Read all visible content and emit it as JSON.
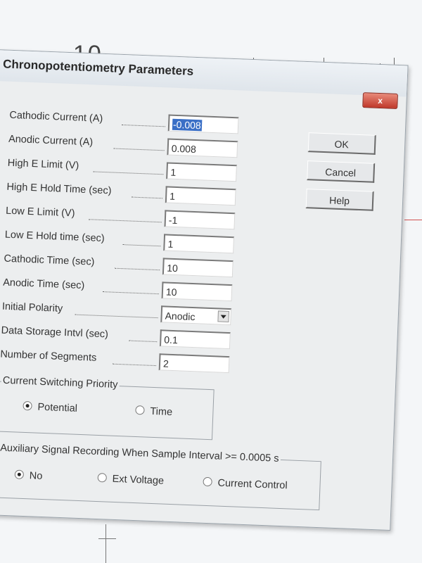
{
  "background": {
    "ruler_label": "10"
  },
  "dialog": {
    "title": "Chronopotentiometry Parameters",
    "close_label": "x"
  },
  "fields": [
    {
      "label": "Cathodic Current (A)",
      "value": "-0.008",
      "selected": true
    },
    {
      "label": "Anodic Current (A)",
      "value": "0.008"
    },
    {
      "label": "High E Limit (V)",
      "value": "1"
    },
    {
      "label": "High E Hold Time (sec)",
      "value": "1"
    },
    {
      "label": "Low E Limit (V)",
      "value": "-1"
    },
    {
      "label": "Low E Hold time (sec)",
      "value": "1"
    },
    {
      "label": "Cathodic Time (sec)",
      "value": "10"
    },
    {
      "label": "Anodic Time (sec)",
      "value": "10"
    },
    {
      "label": "Initial Polarity",
      "value": "Anodic",
      "type": "select"
    },
    {
      "label": "Data Storage Intvl (sec)",
      "value": "0.1"
    },
    {
      "label": "Number of Segments",
      "value": "2"
    }
  ],
  "buttons": {
    "ok": "OK",
    "cancel": "Cancel",
    "help": "Help"
  },
  "switching_group": {
    "title": "Current Switching Priority",
    "options": [
      "Potential",
      "Time"
    ],
    "selected": "Potential"
  },
  "aux_group": {
    "title": "Auxiliary Signal Recording When Sample Interval >= 0.0005 s",
    "options": [
      "No",
      "Ext Voltage",
      "Current Control"
    ],
    "selected": "No"
  },
  "colors": {
    "selection": "#3a6fc6",
    "close_button": "#c0392b"
  }
}
